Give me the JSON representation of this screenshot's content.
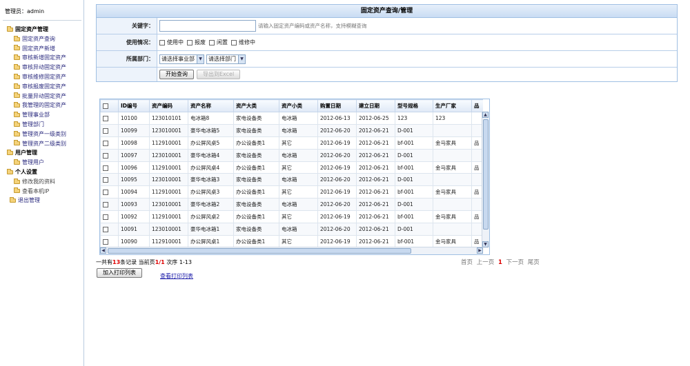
{
  "admin": {
    "label": "管理员：admin"
  },
  "sidebar": {
    "groups": [
      {
        "label": "固定资产管理",
        "items": [
          "固定资产查询",
          "固定资产新增",
          "审核新增固定资产",
          "审核异动固定资产",
          "审核维修固定资产",
          "审核报废固定资产",
          "批量异动固定资产",
          "我管理的固定资产",
          "管理事业部",
          "管理部门",
          "管理资产一级类别",
          "管理资产二级类别"
        ]
      },
      {
        "label": "用户管理",
        "items": [
          "管理用户"
        ]
      },
      {
        "label": "个人设置",
        "items": [
          "修改我的资料",
          "查看本机IP"
        ]
      }
    ],
    "logout": "退出管理"
  },
  "form": {
    "title": "固定资产查询/管理",
    "keyword_label": "关键字：",
    "keyword_value": "",
    "keyword_hint": "请输入固定资产编码或资产名称，支持模糊查询",
    "status_label": "使用情况：",
    "status_options": [
      "使用中",
      "报废",
      "闲置",
      "维修中"
    ],
    "dept_label": "所属部门：",
    "division_select": "请选择事业部",
    "dept_select": "请选择部门",
    "search_button": "开始查询",
    "export_button": "导出到Excel"
  },
  "table": {
    "columns": [
      "",
      "ID编号",
      "资产编码",
      "资产名称",
      "资产大类",
      "资产小类",
      "购置日期",
      "建立日期",
      "型号规格",
      "生产厂家",
      "品"
    ],
    "rows": [
      [
        "10100",
        "123010101",
        "电冰箱8",
        "家电设备类",
        "电冰箱",
        "2012-06-13",
        "2012-06-25",
        "123",
        "123",
        ""
      ],
      [
        "10099",
        "123010001",
        "豪华电冰箱5",
        "家电设备类",
        "电冰箱",
        "2012-06-20",
        "2012-06-21",
        "D-001",
        "",
        ""
      ],
      [
        "10098",
        "112910001",
        "办公屏风桌5",
        "办公设备类1",
        "其它",
        "2012-06-19",
        "2012-06-21",
        "bf-001",
        "金马家具",
        "品"
      ],
      [
        "10097",
        "123010001",
        "豪华电冰箱4",
        "家电设备类",
        "电冰箱",
        "2012-06-20",
        "2012-06-21",
        "D-001",
        "",
        ""
      ],
      [
        "10096",
        "112910001",
        "办公屏风桌4",
        "办公设备类1",
        "其它",
        "2012-06-19",
        "2012-06-21",
        "bf-001",
        "金马家具",
        "品"
      ],
      [
        "10095",
        "123010001",
        "豪华电冰箱3",
        "家电设备类",
        "电冰箱",
        "2012-06-20",
        "2012-06-21",
        "D-001",
        "",
        ""
      ],
      [
        "10094",
        "112910001",
        "办公屏风桌3",
        "办公设备类1",
        "其它",
        "2012-06-19",
        "2012-06-21",
        "bf-001",
        "金马家具",
        "品"
      ],
      [
        "10093",
        "123010001",
        "豪华电冰箱2",
        "家电设备类",
        "电冰箱",
        "2012-06-20",
        "2012-06-21",
        "D-001",
        "",
        ""
      ],
      [
        "10092",
        "112910001",
        "办公屏风桌2",
        "办公设备类1",
        "其它",
        "2012-06-19",
        "2012-06-21",
        "bf-001",
        "金马家具",
        "品"
      ],
      [
        "10091",
        "123010001",
        "豪华电冰箱1",
        "家电设备类",
        "电冰箱",
        "2012-06-20",
        "2012-06-21",
        "D-001",
        "",
        ""
      ],
      [
        "10090",
        "112910001",
        "办公屏风桌1",
        "办公设备类1",
        "其它",
        "2012-06-19",
        "2012-06-21",
        "bf-001",
        "金马家具",
        "品"
      ]
    ]
  },
  "summary": {
    "prefix": "一共有",
    "total": "13",
    "mid": "条记录 当前页",
    "page": "1/1",
    "suffix": " 次序 1-13"
  },
  "pager": {
    "first": "首页",
    "prev": "上一页",
    "current": "1",
    "next": "下一页",
    "last": "尾页"
  },
  "print": {
    "add_button": "加入打印列表",
    "view_link": "查看打印列表"
  }
}
